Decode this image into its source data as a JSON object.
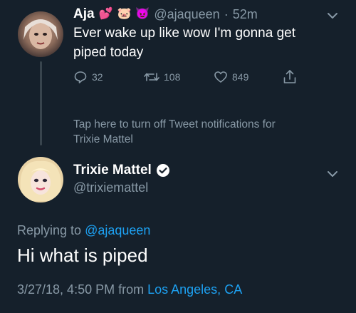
{
  "tweet1": {
    "display_name": "Aja",
    "emojis": [
      "💕",
      "🐷",
      "😈"
    ],
    "handle": "@ajaqueen",
    "separator": "·",
    "time": "52m",
    "text_line1": "Ever wake up like wow I'm gonna get",
    "text_line2": "piped today",
    "replies": "32",
    "retweets": "108",
    "likes": "849"
  },
  "notification": {
    "line1": "Tap here to turn off Tweet notifications for",
    "line2": "Trixie Mattel"
  },
  "tweet2": {
    "display_name": "Trixie Mattel",
    "handle": "@trixiemattel",
    "replying_prefix": "Replying to",
    "replying_handle": "@ajaqueen",
    "text": "Hi what is piped",
    "timestamp": "3/27/18, 4:50 PM from",
    "location": "Los Angeles, CA"
  },
  "colors": {
    "background": "#15202b",
    "muted": "#8899a6",
    "link": "#1da1f2"
  },
  "icons": [
    "reply-icon",
    "retweet-icon",
    "like-icon",
    "share-icon",
    "chevron-down-icon",
    "verified-badge-icon"
  ]
}
